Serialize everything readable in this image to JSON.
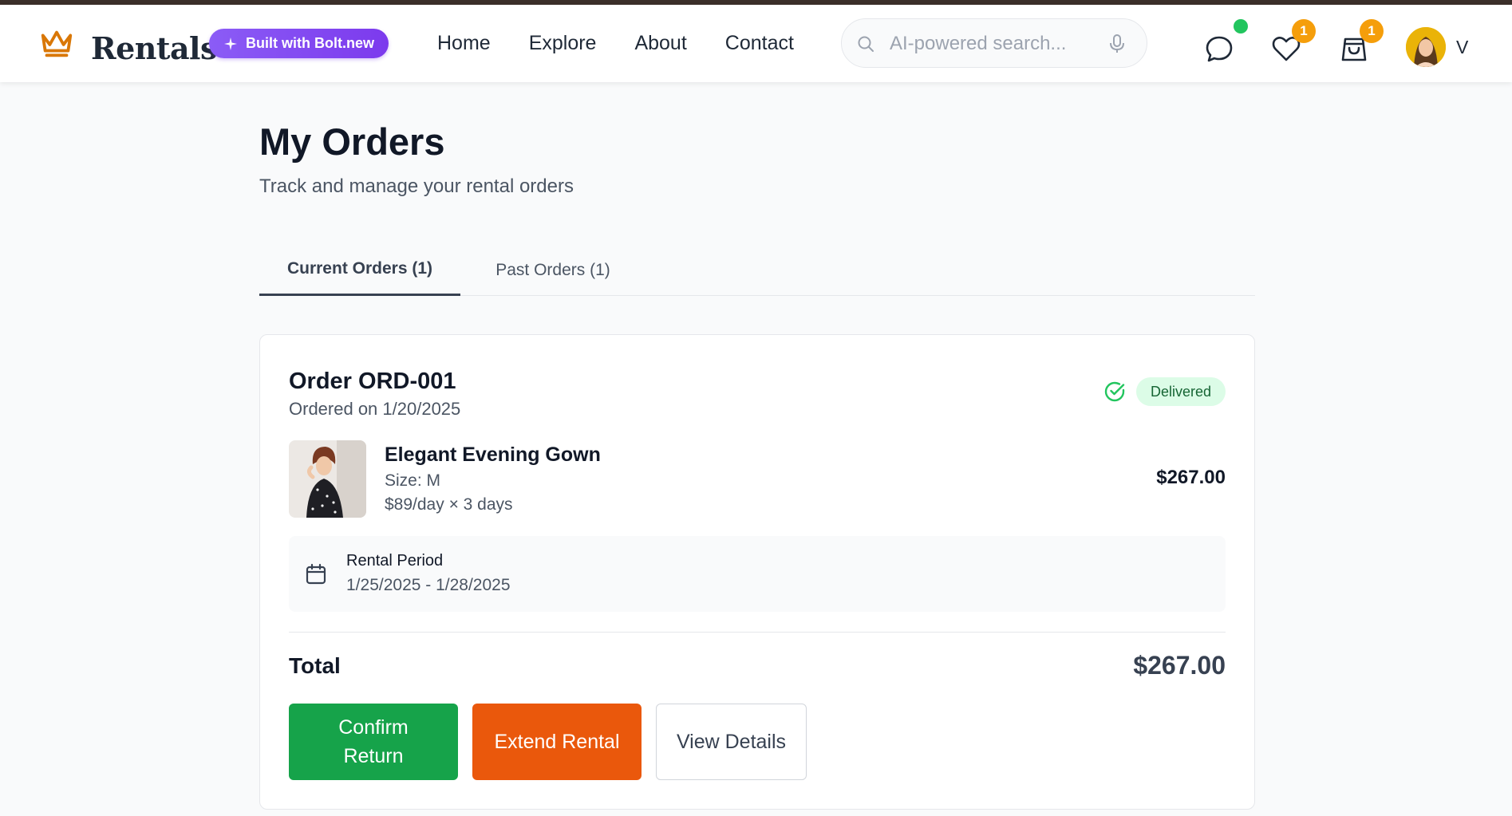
{
  "brand": {
    "name": "Rentals",
    "badge": "Built with Bolt.new",
    "accent": "#d97706"
  },
  "nav": {
    "links": [
      {
        "label": "Home"
      },
      {
        "label": "Explore"
      },
      {
        "label": "About"
      },
      {
        "label": "Contact"
      }
    ]
  },
  "search": {
    "placeholder": "AI-powered search..."
  },
  "header_icons": {
    "messages": {
      "icon": "chat-bubble-icon",
      "online": true
    },
    "wishlist": {
      "icon": "heart-icon",
      "count": "1"
    },
    "cart": {
      "icon": "shopping-bag-icon",
      "count": "1"
    }
  },
  "user": {
    "initial": "V"
  },
  "page": {
    "title": "My Orders",
    "subtitle": "Track and manage your rental orders"
  },
  "tabs": [
    {
      "label": "Current Orders (1)",
      "active": true
    },
    {
      "label": "Past Orders (1)",
      "active": false
    }
  ],
  "order": {
    "id_label": "Order ORD-001",
    "date_label": "Ordered on 1/20/2025",
    "status": "Delivered",
    "status_color": "#22c55e",
    "item": {
      "name": "Elegant Evening Gown",
      "size": "Size: M",
      "rate": "$89/day × 3 days",
      "price": "$267.00"
    },
    "rental": {
      "label": "Rental Period",
      "dates": "1/25/2025 - 1/28/2025"
    },
    "total_label": "Total",
    "total_value": "$267.00",
    "actions": {
      "confirm": "Confirm Return",
      "extend": "Extend Rental",
      "details": "View Details"
    }
  },
  "colors": {
    "confirm": "#16a34a",
    "extend": "#ea580c",
    "badge": "#f59e0b"
  }
}
